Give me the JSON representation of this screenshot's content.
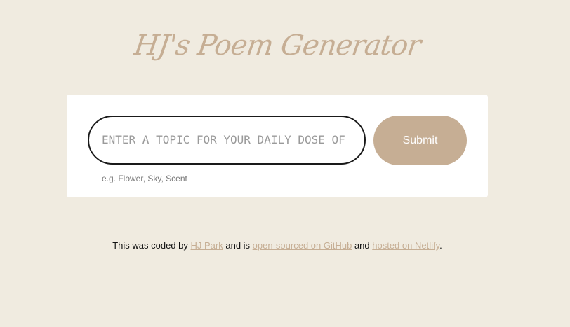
{
  "header": {
    "title": "HJ's Poem Generator"
  },
  "form": {
    "input_placeholder": "Enter a topic for your daily dose of poetry",
    "input_value": "",
    "submit_label": "Submit",
    "hint": "e.g. Flower, Sky, Scent"
  },
  "footer": {
    "text_1": "This was coded by ",
    "author_link": "HJ Park",
    "text_2": " and is ",
    "github_link": "open-sourced on GitHub",
    "text_3": " and ",
    "netlify_link": "hosted on Netlify",
    "text_4": "."
  },
  "colors": {
    "background": "#f0ebe0",
    "accent": "#c6ae94",
    "card": "#ffffff"
  }
}
